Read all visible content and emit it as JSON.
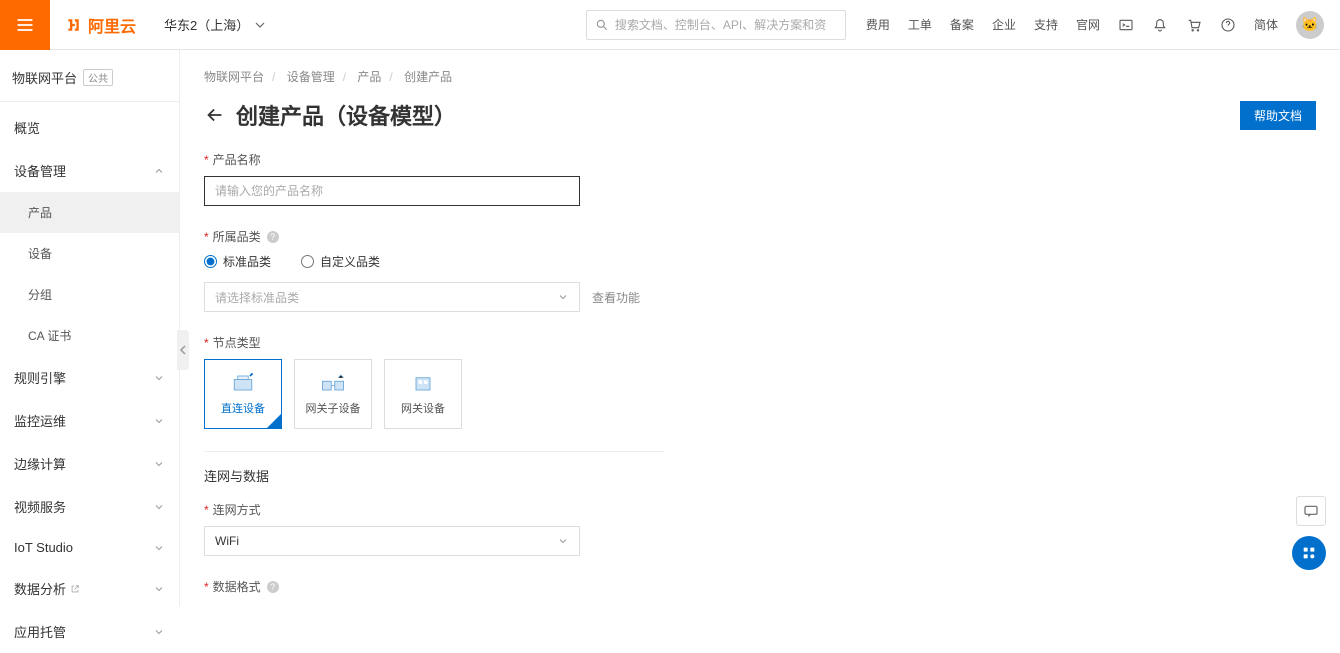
{
  "header": {
    "brand": "阿里云",
    "region": "华东2（上海）",
    "search_placeholder": "搜索文档、控制台、API、解决方案和资",
    "nav": {
      "fees": "费用",
      "tickets": "工单",
      "icp": "备案",
      "enterprise": "企业",
      "support": "支持",
      "site": "官网",
      "lang": "简体"
    }
  },
  "sidebar": {
    "product_title": "物联网平台",
    "product_badge": "公共",
    "items": {
      "overview": "概览",
      "device_mgmt": "设备管理",
      "product": "产品",
      "device": "设备",
      "group": "分组",
      "ca": "CA 证书",
      "rule": "规则引擎",
      "monitor": "监控运维",
      "edge": "边缘计算",
      "video": "视频服务",
      "iot_studio": "IoT Studio",
      "analytics": "数据分析",
      "hosting": "应用托管"
    }
  },
  "breadcrumb": {
    "a": "物联网平台",
    "b": "设备管理",
    "c": "产品",
    "d": "创建产品"
  },
  "page": {
    "title": "创建产品（设备模型）",
    "help_btn": "帮助文档",
    "section_net": "连网与数据"
  },
  "form": {
    "name_label": "产品名称",
    "name_placeholder": "请输入您的产品名称",
    "cat_label": "所属品类",
    "cat_standard": "标准品类",
    "cat_custom": "自定义品类",
    "cat_select_placeholder": "请选择标准品类",
    "view_features": "查看功能",
    "node_label": "节点类型",
    "node_direct": "直连设备",
    "node_child": "网关子设备",
    "node_gateway": "网关设备",
    "net_label": "连网方式",
    "net_value": "WiFi",
    "fmt_label": "数据格式"
  }
}
